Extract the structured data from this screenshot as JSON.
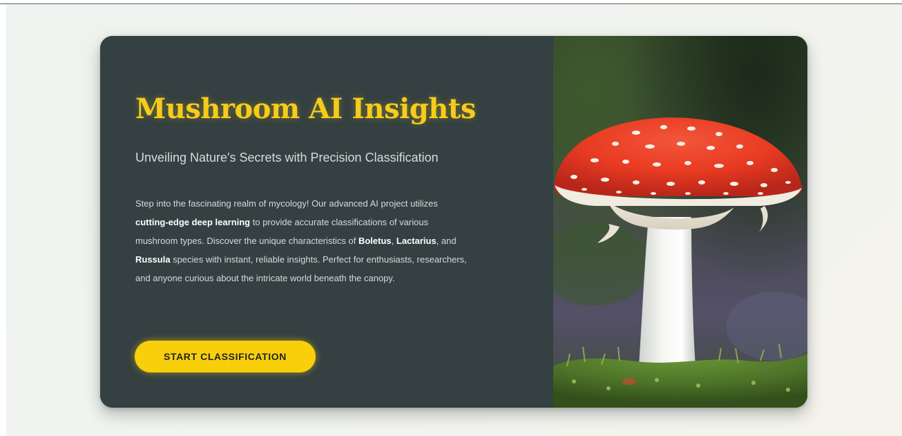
{
  "hero": {
    "title": "Mushroom AI Insights",
    "subtitle": "Unveiling Nature's Secrets with Precision Classification",
    "description": {
      "p1": "Step into the fascinating realm of mycology! Our advanced AI project utilizes ",
      "b1": "cutting-edge deep learning",
      "p2": " to provide accurate classifications of various mushroom types. Discover the unique characteristics of ",
      "b2": "Boletus",
      "p3": ", ",
      "b3": "Lactarius",
      "p4": ", and ",
      "b4": "Russula",
      "p5": " species with instant, reliable insights. Perfect for enthusiasts, researchers, and anyone curious about the intricate world beneath the canopy."
    },
    "cta_label": "START CLASSIFICATION"
  },
  "image": {
    "icon": "amanita-mushroom-photo"
  },
  "colors": {
    "accent": "#f6cc1b",
    "card_bg": "#344041",
    "page_bg": "#eff3ef"
  }
}
